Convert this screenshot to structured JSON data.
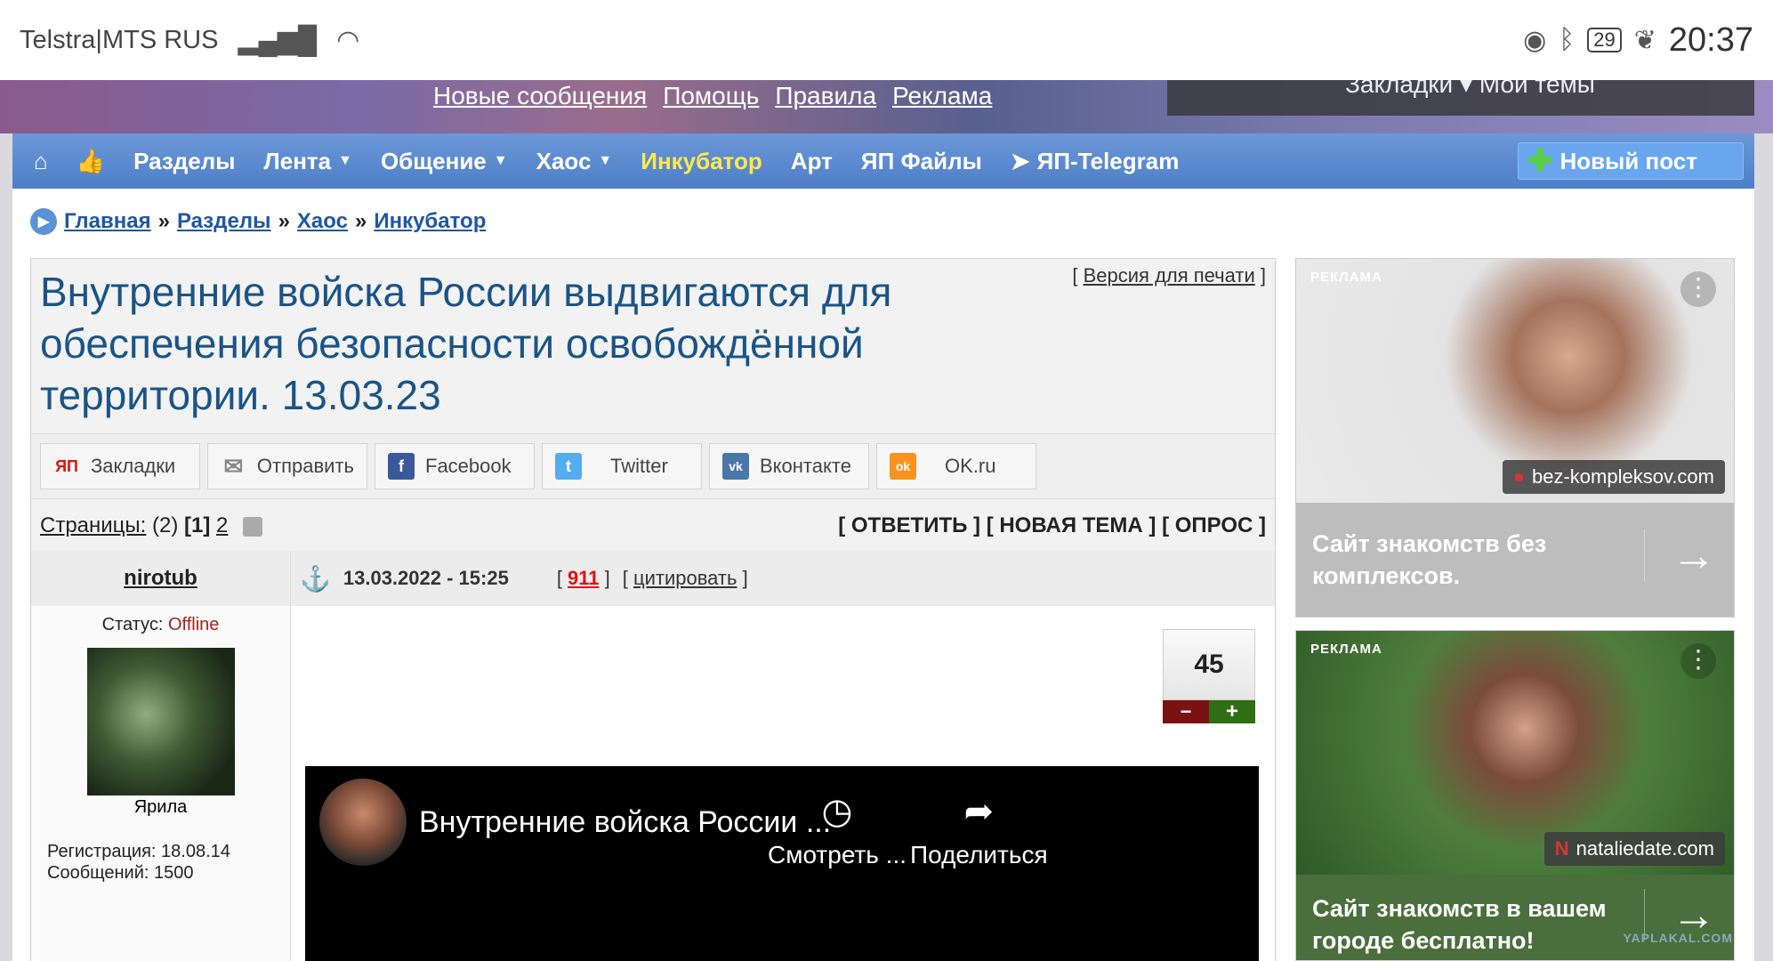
{
  "statusbar": {
    "carrier": "Telstra|MTS RUS",
    "battery": "29",
    "time": "20:37"
  },
  "header": {
    "links": [
      "Новые сообщения",
      "Помощь",
      "Правила",
      "Реклама"
    ],
    "user_menu": "Закладки ▾   Мои темы"
  },
  "nav": {
    "items": [
      {
        "label": "Разделы",
        "caret": false,
        "highlight": false
      },
      {
        "label": "Лента",
        "caret": true,
        "highlight": false
      },
      {
        "label": "Общение",
        "caret": true,
        "highlight": false
      },
      {
        "label": "Хаос",
        "caret": true,
        "highlight": false
      },
      {
        "label": "Инкубатор",
        "caret": false,
        "highlight": true
      },
      {
        "label": "Арт",
        "caret": false,
        "highlight": false
      },
      {
        "label": "ЯП Файлы",
        "caret": false,
        "highlight": false
      },
      {
        "label": "ЯП-Telegram",
        "caret": false,
        "highlight": false
      }
    ],
    "new_post": "Новый пост"
  },
  "breadcrumb": {
    "items": [
      "Главная",
      "Разделы",
      "Хаос",
      "Инкубатор"
    ],
    "sep": "»"
  },
  "topic": {
    "title": "Внутренние войска России выдвигаются для обеспечения безопасности освобождённой территории. 13.03.23",
    "print_version": "Версия для печати"
  },
  "share": [
    {
      "label": "Закладки",
      "icon": "yp-icon",
      "color": "#ffffff",
      "glyph": "ЯП",
      "fg": "#d11"
    },
    {
      "label": "Отправить",
      "icon": "mail-icon",
      "color": "#ffffff",
      "glyph": "✉",
      "fg": "#888"
    },
    {
      "label": "Facebook",
      "icon": "facebook-icon",
      "color": "#3b5998",
      "glyph": "f",
      "fg": "#fff"
    },
    {
      "label": "Twitter",
      "icon": "twitter-icon",
      "color": "#55acee",
      "glyph": "t",
      "fg": "#fff"
    },
    {
      "label": "Вконтакте",
      "icon": "vk-icon",
      "color": "#4a76a8",
      "glyph": "vk",
      "fg": "#fff"
    },
    {
      "label": "OK.ru",
      "icon": "ok-icon",
      "color": "#f7931e",
      "glyph": "ok",
      "fg": "#fff"
    }
  ],
  "pages": {
    "label": "Страницы:",
    "count": "(2)",
    "current": "[1]",
    "next": "2"
  },
  "actions": {
    "reply": "[ ОТВЕТИТЬ ]",
    "new_topic": "[ НОВАЯ ТЕМА ]",
    "poll": "[ ОПРОС ]"
  },
  "post": {
    "author": "nirotub",
    "status_label": "Статус:",
    "status_value": "Offline",
    "avatar_caption": "Ярила",
    "registration": "Регистрация: 18.08.14",
    "messages": "Сообщений: 1500",
    "date": "13.03.2022 - 15:25",
    "number": "911",
    "quote": "цитировать",
    "rating": "45"
  },
  "video": {
    "title": "Внутренние войска России ...",
    "watch_label": "Смотреть ...",
    "share_label": "Поделиться"
  },
  "ads": [
    {
      "tag": "РЕКЛАМА",
      "domain": "bez-kompleksov.com",
      "text": "Сайт знакомств без комплексов."
    },
    {
      "tag": "РЕКЛАМА",
      "domain": "nataliedate.com",
      "text": "Сайт знакомств в вашем городе бесплатно!"
    }
  ],
  "watermark": "YAPLAKAL.COM"
}
